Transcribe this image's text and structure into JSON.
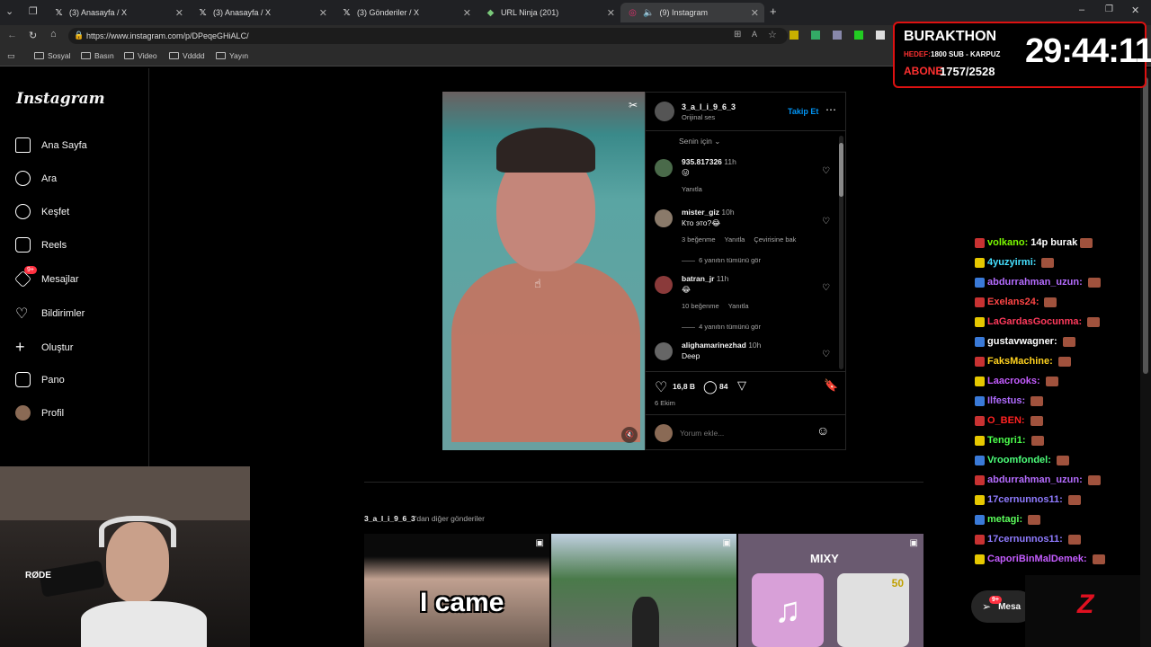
{
  "tabs": [
    {
      "label": "(3) Anasayfa / X",
      "icon": "x-logo-icon"
    },
    {
      "label": "(3) Anasayfa / X",
      "icon": "x-logo-icon"
    },
    {
      "label": "(3) Gönderiler / X",
      "icon": "x-logo-icon"
    },
    {
      "label": "URL Ninja (201)",
      "icon": "url-ninja-icon"
    },
    {
      "label": "(9) Instagram",
      "icon": "instagram-icon"
    }
  ],
  "url": "https://www.instagram.com/p/DPeqeGHiALC/",
  "bookmarks": [
    "Sosyal",
    "Basın",
    "Video",
    "Vdddd",
    "Yayın"
  ],
  "sidebar": {
    "logo": "Instagram",
    "items": [
      {
        "label": "Ana Sayfa"
      },
      {
        "label": "Ara"
      },
      {
        "label": "Keşfet"
      },
      {
        "label": "Reels"
      },
      {
        "label": "Mesajlar",
        "badge": "9+"
      },
      {
        "label": "Bildirimler"
      },
      {
        "label": "Oluştur"
      },
      {
        "label": "Pano"
      },
      {
        "label": "Profil"
      }
    ]
  },
  "post": {
    "username": "3_a_l_i_9_6_3",
    "audio": "Orijinal ses",
    "follow": "Takip Et",
    "sort": "Senin için",
    "comments": [
      {
        "user": "935.817326",
        "time": "11h",
        "text": "😛",
        "reply": "Yanıtla"
      },
      {
        "user": "mister_giz",
        "time": "10h",
        "text": "Кто это?😂",
        "likes": "3 beğenme",
        "reply": "Yanıtla",
        "translate": "Çevirisine bak",
        "view_replies": "6 yanıtın tümünü gör"
      },
      {
        "user": "batran_jr",
        "time": "11h",
        "text": "😂",
        "likes": "10 beğenme",
        "reply": "Yanıtla",
        "view_replies": "4 yanıtın tümünü gör"
      },
      {
        "user": "alighamarinezhad",
        "time": "10h",
        "text": "Deep"
      }
    ],
    "like_count": "16,8 B",
    "comment_count": "84",
    "date": "6 Ekim",
    "comment_placeholder": "Yorum ekle..."
  },
  "more_posts": {
    "heading_user": "3_a_l_i_9_6_3",
    "heading_suffix": "'dan diğer gönderiler",
    "thumb1_text": "I came",
    "thumb3_text": "MIXY",
    "thumb3_badge": "50"
  },
  "messages_float": {
    "label": "Mesa",
    "badge": "9+"
  },
  "stream": {
    "title": "BURAKTHON",
    "line_hedef_label": "HEDEF:",
    "line_hedef": "1800 SUB - KARPUZ",
    "abone_label": "ABONE",
    "abone_value": "1757/2528",
    "timer": "29:44:11"
  },
  "webcam_brand": "RØDE",
  "chat": [
    {
      "user": "volkano:",
      "msg": "14p burak",
      "color": "#7cfc00"
    },
    {
      "user": "4yuzyirmi:",
      "msg": "",
      "color": "#46e0ff"
    },
    {
      "user": "abdurrahman_uzun:",
      "msg": "",
      "color": "#b56cff"
    },
    {
      "user": "Exelans24:",
      "msg": "",
      "color": "#ff4646"
    },
    {
      "user": "LaGardasGocunma:",
      "msg": "",
      "color": "#ff3a5c"
    },
    {
      "user": "gustavwagner:",
      "msg": "",
      "color": "#ffffff"
    },
    {
      "user": "FaksMachine:",
      "msg": "",
      "color": "#ffd21f"
    },
    {
      "user": "Laacrooks:",
      "msg": "",
      "color": "#c45cff"
    },
    {
      "user": "Ilfestus:",
      "msg": "",
      "color": "#b06cff"
    },
    {
      "user": "O_BEN:",
      "msg": "",
      "color": "#ff2222"
    },
    {
      "user": "Tengri1:",
      "msg": "",
      "color": "#4cff4c"
    },
    {
      "user": "Vroomfondel:",
      "msg": "",
      "color": "#4cff7a"
    },
    {
      "user": "abdurrahman_uzun:",
      "msg": "",
      "color": "#b56cff"
    },
    {
      "user": "17cernunnos11:",
      "msg": "",
      "color": "#8f7bff"
    },
    {
      "user": "metagi:",
      "msg": "",
      "color": "#5cff5c"
    },
    {
      "user": "17cernunnos11:",
      "msg": "",
      "color": "#8f7bff"
    },
    {
      "user": "CaporiBinMalDemek:",
      "msg": "",
      "color": "#c45cff"
    }
  ]
}
